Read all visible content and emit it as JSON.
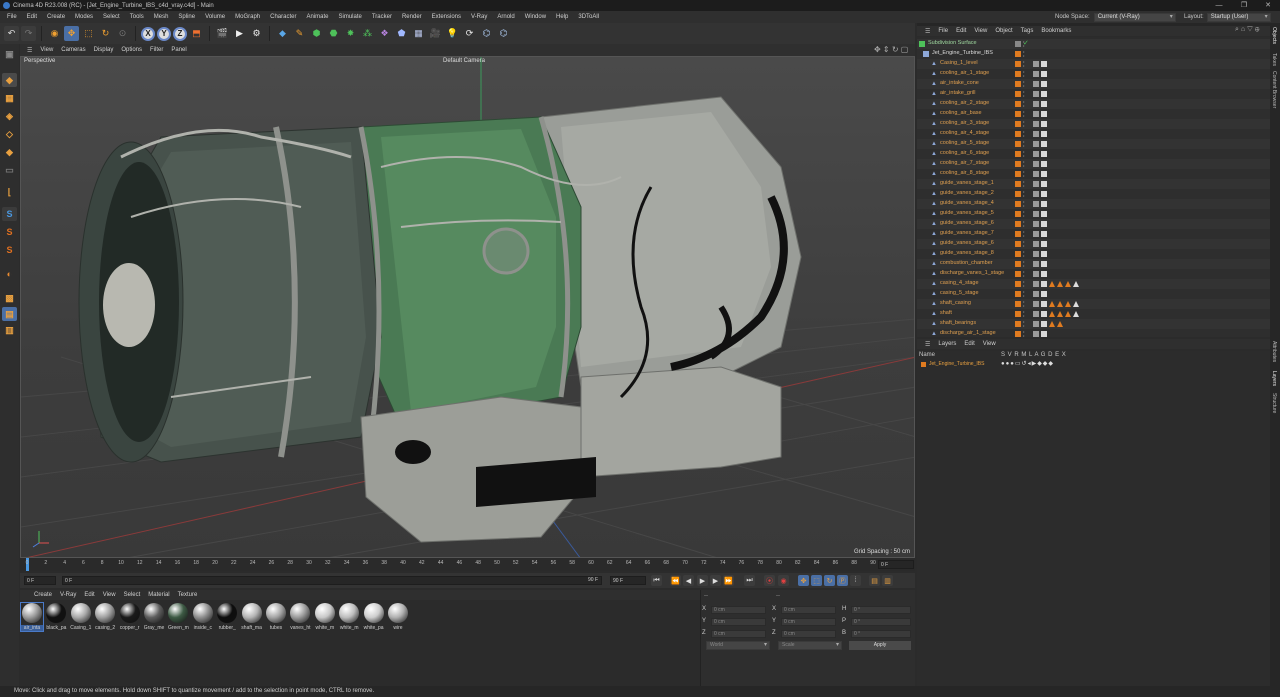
{
  "window": {
    "title": "Cinema 4D R23.008 (RC) - [Jet_Engine_Turbine_IBS_c4d_vray.c4d] - Main",
    "controls": [
      "—",
      "❐",
      "✕"
    ]
  },
  "menubar": {
    "items": [
      "File",
      "Edit",
      "Create",
      "Modes",
      "Select",
      "Tools",
      "Mesh",
      "Spline",
      "Volume",
      "MoGraph",
      "Character",
      "Animate",
      "Simulate",
      "Tracker",
      "Render",
      "Extensions",
      "V-Ray",
      "Arnold",
      "Window",
      "Help",
      "3DToAll"
    ],
    "node_space_label": "Node Space:",
    "node_space_value": "Current (V-Ray)",
    "layout_label": "Layout:",
    "layout_value": "Startup (User)"
  },
  "toolbar": {
    "x_label": "X",
    "y_label": "Y",
    "z_label": "Z"
  },
  "viewport": {
    "menu": [
      "View",
      "Cameras",
      "Display",
      "Options",
      "Filter",
      "Panel"
    ],
    "projection": "Perspective",
    "camera": "Default Camera",
    "grid_spacing": "Grid Spacing : 50 cm"
  },
  "timeline": {
    "ticks": [
      "0",
      "2",
      "4",
      "6",
      "8",
      "10",
      "12",
      "14",
      "16",
      "18",
      "20",
      "22",
      "24",
      "26",
      "28",
      "30",
      "32",
      "34",
      "36",
      "38",
      "40",
      "42",
      "44",
      "46",
      "48",
      "50",
      "52",
      "54",
      "56",
      "58",
      "60",
      "62",
      "64",
      "66",
      "68",
      "70",
      "72",
      "74",
      "76",
      "78",
      "80",
      "82",
      "84",
      "86",
      "88",
      "90"
    ],
    "current_frame": "0 F",
    "start": "0 F",
    "min_field": "0 F",
    "max_field": "90 F",
    "end": "90 F"
  },
  "material_manager": {
    "menu": [
      "Create",
      "V-Ray",
      "Edit",
      "View",
      "Select",
      "Material",
      "Texture"
    ],
    "materials": [
      {
        "name": "air_inta",
        "color": "#9a9a9a"
      },
      {
        "name": "black_pa",
        "color": "#111111"
      },
      {
        "name": "Casing_1",
        "color": "#a9a9a9"
      },
      {
        "name": "casing_2",
        "color": "#a0a0a0"
      },
      {
        "name": "copper_r",
        "color": "#1a1a1a"
      },
      {
        "name": "Gray_me",
        "color": "#5e5e5e"
      },
      {
        "name": "Green_m",
        "color": "#3d5a44"
      },
      {
        "name": "inside_c",
        "color": "#8e8e8e"
      },
      {
        "name": "rubber_",
        "color": "#0d0d0d"
      },
      {
        "name": "shaft_ma",
        "color": "#b4b4b4"
      },
      {
        "name": "tubes",
        "color": "#a4a4a4"
      },
      {
        "name": "vanes_ht",
        "color": "#9a9a9a"
      },
      {
        "name": "white_m",
        "color": "#c8c8c8"
      },
      {
        "name": "white_m",
        "color": "#bdbdbd"
      },
      {
        "name": "white_pa",
        "color": "#cdcdcd"
      },
      {
        "name": "wire",
        "color": "#b0b0b0"
      }
    ]
  },
  "coordinates": {
    "header_a": "--",
    "header_b": "--",
    "rows": [
      {
        "a": "X",
        "av": "0 cm",
        "b": "X",
        "bv": "0 cm",
        "c": "H",
        "cv": "0 °"
      },
      {
        "a": "Y",
        "av": "0 cm",
        "b": "Y",
        "bv": "0 cm",
        "c": "P",
        "cv": "0 °"
      },
      {
        "a": "Z",
        "av": "0 cm",
        "b": "Z",
        "bv": "0 cm",
        "c": "B",
        "cv": "0 °"
      }
    ],
    "mode": "World",
    "scale": "Scale",
    "apply": "Apply"
  },
  "status_bar": "Move: Click and drag to move elements. Hold down SHIFT to quantize movement / add to the selection in point mode, CTRL to remove.",
  "object_manager": {
    "menu": [
      "File",
      "Edit",
      "View",
      "Object",
      "Tags",
      "Bookmarks"
    ],
    "objects": [
      {
        "name": "Subdivision Surface",
        "level": 0,
        "tags": 0
      },
      {
        "name": "Jet_Engine_Turbine_IBS",
        "level": 1,
        "tags": 0
      },
      {
        "name": "Casing_1_level",
        "level": 2,
        "tags": 2
      },
      {
        "name": "cooling_air_1_stage",
        "level": 2,
        "tags": 2
      },
      {
        "name": "air_intake_cone",
        "level": 2,
        "tags": 2
      },
      {
        "name": "air_intake_grill",
        "level": 2,
        "tags": 2
      },
      {
        "name": "cooling_air_2_stage",
        "level": 2,
        "tags": 2
      },
      {
        "name": "cooling_air_base",
        "level": 2,
        "tags": 2
      },
      {
        "name": "cooling_air_3_stage",
        "level": 2,
        "tags": 2
      },
      {
        "name": "cooling_air_4_stage",
        "level": 2,
        "tags": 2
      },
      {
        "name": "cooling_air_5_stage",
        "level": 2,
        "tags": 2
      },
      {
        "name": "cooling_air_6_stage",
        "level": 2,
        "tags": 2
      },
      {
        "name": "cooling_air_7_stage",
        "level": 2,
        "tags": 2
      },
      {
        "name": "cooling_air_8_stage",
        "level": 2,
        "tags": 2
      },
      {
        "name": "guide_vanes_stage_1",
        "level": 2,
        "tags": 2
      },
      {
        "name": "guide_vanes_stage_2",
        "level": 2,
        "tags": 2
      },
      {
        "name": "guide_vanes_stage_4",
        "level": 2,
        "tags": 2
      },
      {
        "name": "guide_vanes_stage_5",
        "level": 2,
        "tags": 2
      },
      {
        "name": "guide_vanes_stage_6",
        "level": 2,
        "tags": 2
      },
      {
        "name": "guide_vanes_stage_7",
        "level": 2,
        "tags": 2
      },
      {
        "name": "guide_vanes_stage_6",
        "level": 2,
        "tags": 2
      },
      {
        "name": "guide_vanes_stage_8",
        "level": 2,
        "tags": 2
      },
      {
        "name": "combustion_chamber",
        "level": 2,
        "tags": 2
      },
      {
        "name": "discharge_vanes_1_stage",
        "level": 2,
        "tags": 2
      },
      {
        "name": "casing_4_stage",
        "level": 2,
        "tags": 6
      },
      {
        "name": "casing_5_stage",
        "level": 2,
        "tags": 2
      },
      {
        "name": "shaft_casing",
        "level": 2,
        "tags": 6
      },
      {
        "name": "shaft",
        "level": 2,
        "tags": 6
      },
      {
        "name": "shaft_bearings",
        "level": 2,
        "tags": 4
      },
      {
        "name": "discharge_air_1_stage",
        "level": 2,
        "tags": 2
      }
    ]
  },
  "layers": {
    "menu": [
      "Layers",
      "Edit",
      "View"
    ],
    "header_name": "Name",
    "header_cols": "S V R M L A G D E X",
    "items": [
      {
        "name": "Jet_Engine_Turbine_IBS",
        "color": "#e07b20"
      }
    ]
  },
  "right_tabs": [
    "Objects",
    "Takes",
    "Content Browser",
    "Attributes",
    "Layers",
    "Structure"
  ]
}
